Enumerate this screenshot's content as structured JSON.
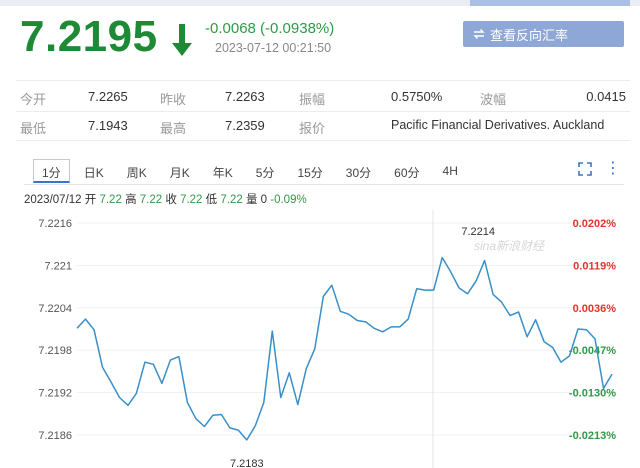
{
  "quote": {
    "price": "7.2195",
    "change": "-0.0068 (-0.0938%)",
    "time": "2023-07-12 00:21:50",
    "reverse_button": "查看反向汇率",
    "down_color": "#1e8a35"
  },
  "stats": {
    "row1": [
      {
        "label": "今开",
        "value": "7.2265"
      },
      {
        "label": "昨收",
        "value": "7.2263"
      },
      {
        "label": "振幅",
        "value": "0.5750%"
      },
      {
        "label": "波幅",
        "value": "0.0415"
      }
    ],
    "row2": [
      {
        "label": "最低",
        "value": "7.1943"
      },
      {
        "label": "最高",
        "value": "7.2359"
      },
      {
        "label": "报价",
        "value": "Pacific Financial Derivatives. Auckland"
      }
    ]
  },
  "tabs": [
    "1分",
    "日K",
    "周K",
    "月K",
    "年K",
    "5分",
    "15分",
    "30分",
    "60分",
    "4H"
  ],
  "active_tab": "1分",
  "toolbar": {
    "expand_icon": "expand-icon",
    "more_icon": "more-icon"
  },
  "infoline": {
    "date": "2023/07/12",
    "open_label": "开",
    "open": "7.22",
    "high_label": "高",
    "high": "7.22",
    "close_label": "收",
    "close": "7.22",
    "low_label": "低",
    "low": "7.22",
    "vol_label": "量",
    "vol": "0",
    "pct": "-0.09%"
  },
  "watermark": "sina新浪财经",
  "chart_data": {
    "type": "line",
    "y_ticks": [
      "7.2216",
      "7.221",
      "7.2204",
      "7.2198",
      "7.2192",
      "7.2186"
    ],
    "pct_ticks": [
      "0.0202%",
      "0.0119%",
      "0.0036%",
      "-0.0047%",
      "-0.0130%",
      "-0.0213%"
    ],
    "ylim": [
      7.2183,
      7.2217
    ],
    "max_label": "7.2214",
    "min_label": "7.2183",
    "line_color": "#3a8fc8",
    "pos_color": "#e5332a",
    "neg_color": "#2f9a47",
    "values": [
      7.22011,
      7.22024,
      7.22009,
      7.21956,
      7.21935,
      7.21913,
      7.21902,
      7.21919,
      7.21963,
      7.2196,
      7.21933,
      7.21966,
      7.21971,
      7.21906,
      7.21883,
      7.21872,
      7.21888,
      7.21889,
      7.2187,
      7.21867,
      7.21853,
      7.21873,
      7.21906,
      7.22007,
      7.21913,
      7.21948,
      7.21903,
      7.21954,
      7.21982,
      7.22056,
      7.22072,
      7.22035,
      7.22031,
      7.22022,
      7.2202,
      7.22011,
      7.22006,
      7.22013,
      7.22013,
      7.22024,
      7.22067,
      7.22065,
      7.22065,
      7.22111,
      7.22091,
      7.22068,
      7.2206,
      7.22078,
      7.22107,
      7.22059,
      7.22048,
      7.22029,
      7.22034,
      7.21999,
      7.22023,
      7.21992,
      7.21984,
      7.21963,
      7.21972,
      7.2201,
      7.22009,
      7.21996,
      7.21926,
      7.21946
    ]
  }
}
